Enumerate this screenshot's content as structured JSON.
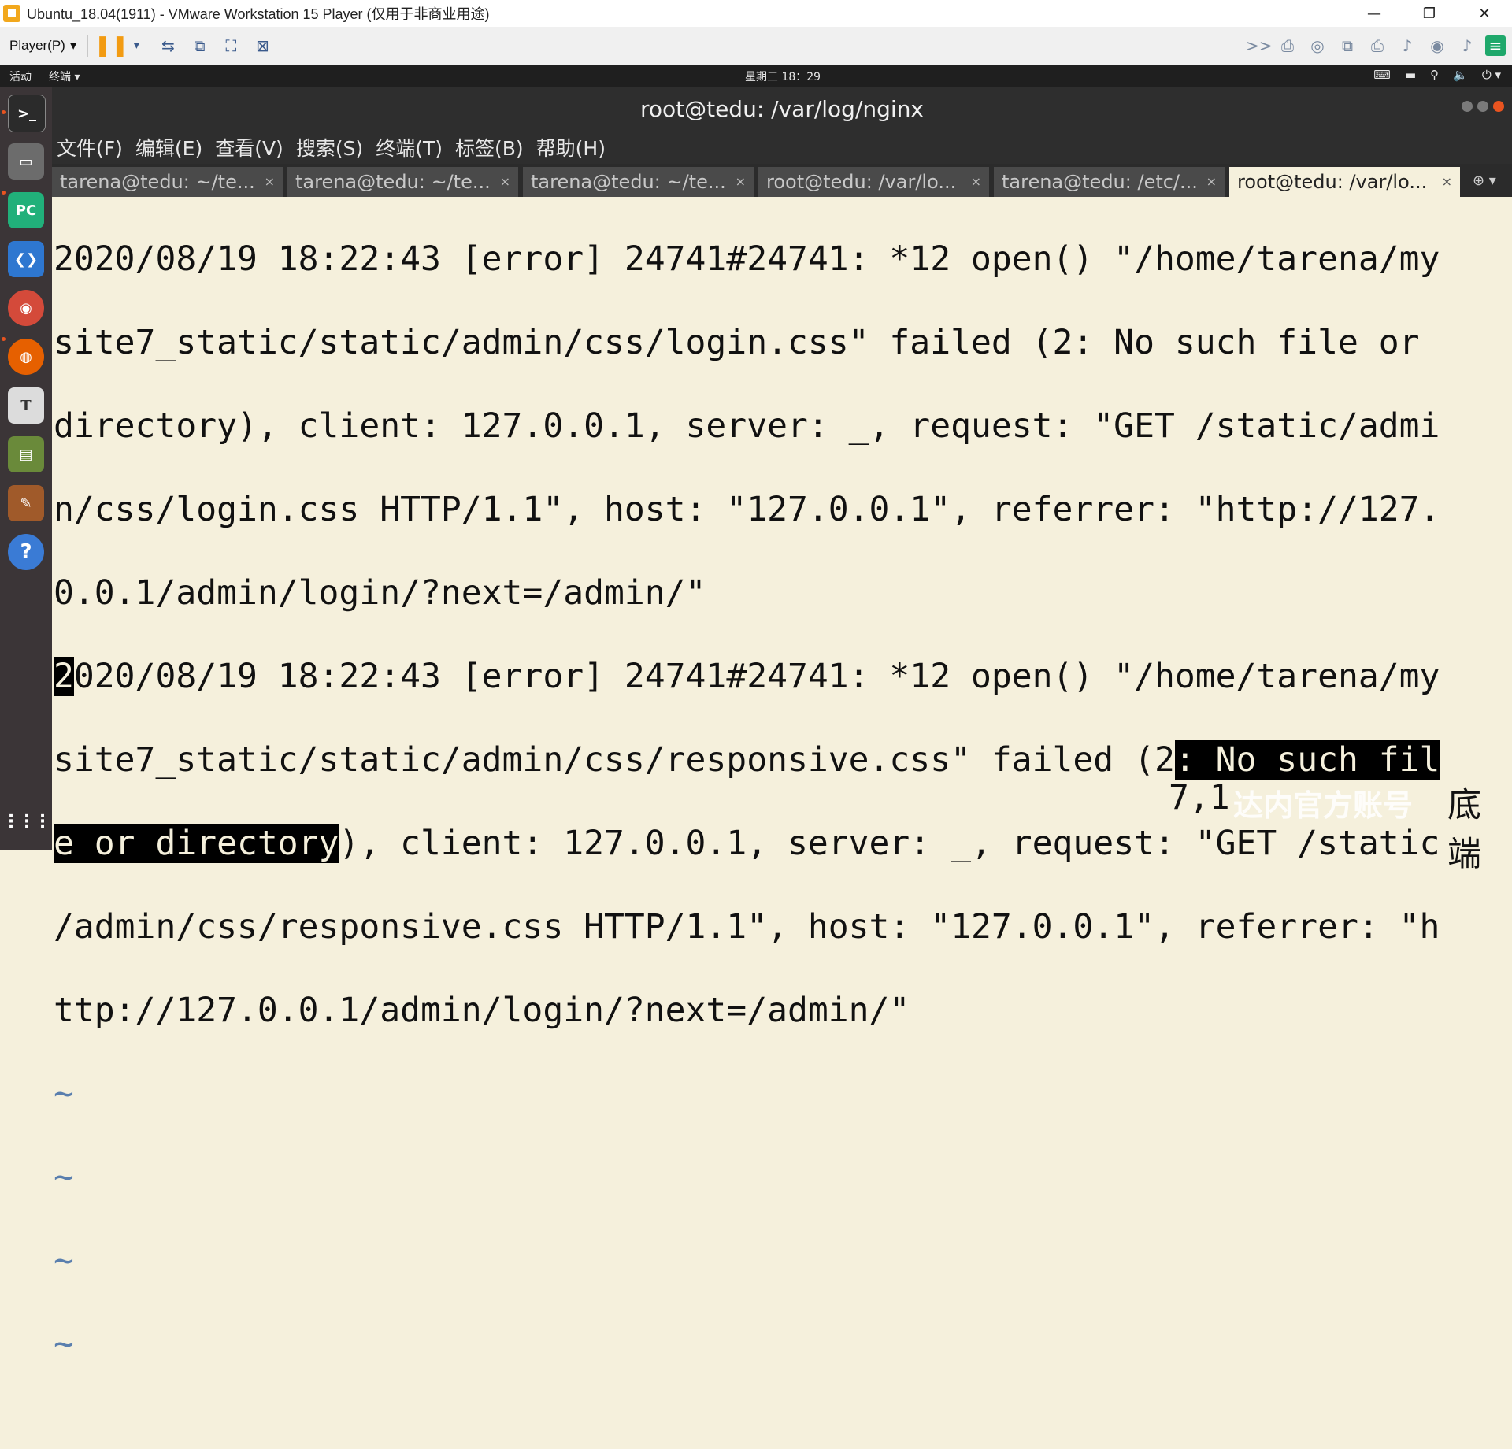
{
  "window": {
    "title": "Ubuntu_18.04(1911) - VMware Workstation 15 Player (仅用于非商业用途)",
    "controls": [
      "—",
      "❐",
      "✕"
    ]
  },
  "vmware": {
    "player_menu": "Player(P)",
    "dropdown_glyph": "▾",
    "pause_glyph": "❚❚",
    "left_icons": [
      "send-ctrl-alt-del-icon",
      "removable-devices-icon",
      "fullscreen-icon",
      "unity-icon"
    ],
    "left_glyphs": [
      "⇆",
      "⧉",
      "⛶",
      "⊠"
    ],
    "right_glyphs": [
      ">>",
      "⎙",
      "◎",
      "⧉",
      "⎙",
      "♪",
      "◉",
      "♪",
      "≡"
    ]
  },
  "gnome": {
    "activities": "活动",
    "app_menu": "终端 ▾",
    "clock": "星期三 18：29",
    "tray": [
      "⌨",
      "▬",
      "⚲",
      "🔈",
      "⏻ ▾"
    ]
  },
  "dock": {
    "apps": [
      {
        "name": "terminal-icon",
        "glyph": ">_",
        "color": "#2b2b2b"
      },
      {
        "name": "file-manager-icon",
        "glyph": "▭",
        "color": "#6c6c6c"
      },
      {
        "name": "pycharm-icon",
        "glyph": "PC",
        "color": "#21b07a"
      },
      {
        "name": "vscode-icon",
        "glyph": "❮❯",
        "color": "#2e77d0"
      },
      {
        "name": "chrome-icon",
        "glyph": "◉",
        "color": "#d44a3a"
      },
      {
        "name": "firefox-icon",
        "glyph": "◍",
        "color": "#e66000"
      },
      {
        "name": "text-editor-icon",
        "glyph": "T",
        "color": "#dcdcdc"
      },
      {
        "name": "book-app-icon",
        "glyph": "▤",
        "color": "#6a8a3a"
      },
      {
        "name": "tools-icon",
        "glyph": "✎",
        "color": "#a05a2a"
      },
      {
        "name": "help-icon",
        "glyph": "?",
        "color": "#3a7bd5"
      }
    ],
    "show_apps_glyph": "⋮⋮⋮"
  },
  "terminal": {
    "title": "root@tedu: /var/log/nginx",
    "menu": [
      "文件(F)",
      "编辑(E)",
      "查看(V)",
      "搜索(S)",
      "终端(T)",
      "标签(B)",
      "帮助(H)"
    ],
    "tabs": [
      {
        "label": "tarena@tedu: ~/te...",
        "close": "×"
      },
      {
        "label": "tarena@tedu: ~/te...",
        "close": "×"
      },
      {
        "label": "tarena@tedu: ~/te...",
        "close": "×"
      },
      {
        "label": "root@tedu: /var/lo...",
        "close": "×"
      },
      {
        "label": "tarena@tedu: /etc/...",
        "close": "×"
      },
      {
        "label": "root@tedu: /var/lo...",
        "close": "×"
      }
    ],
    "new_tab_glyph": "⊕ ▾",
    "log_lines": [
      "2020/08/19 18:22:43 [error] 24741#24741: *12 open() \"/home/tarena/my",
      "site7_static/static/admin/css/login.css\" failed (2: No such file or ",
      "directory), client: 127.0.0.1, server: _, request: \"GET /static/admi",
      "n/css/login.css HTTP/1.1\", host: \"127.0.0.1\", referrer: \"http://127.",
      "0.0.1/admin/login/?next=/admin/\""
    ],
    "line6_cursor": "2",
    "line6_rest": "020/08/19 18:22:43 [error] 24741#24741: *12 open() \"/home/tarena/my",
    "line7_plain": "site7_static/static/admin/css/responsive.css\" failed (2",
    "line7_highlight": ": No such fil",
    "line8_highlight": "e or directory",
    "line8_plain": "), client: 127.0.0.1, server: _, request: \"GET /static",
    "line9": "/admin/css/responsive.css HTTP/1.1\", host: \"127.0.0.1\", referrer: \"h",
    "line10": "ttp://127.0.0.1/admin/login/?next=/admin/\"",
    "tildes": [
      "~",
      "~",
      "~",
      "~"
    ],
    "status_position": "7,1",
    "watermark": "达内官方账号",
    "status_end": "底端"
  }
}
